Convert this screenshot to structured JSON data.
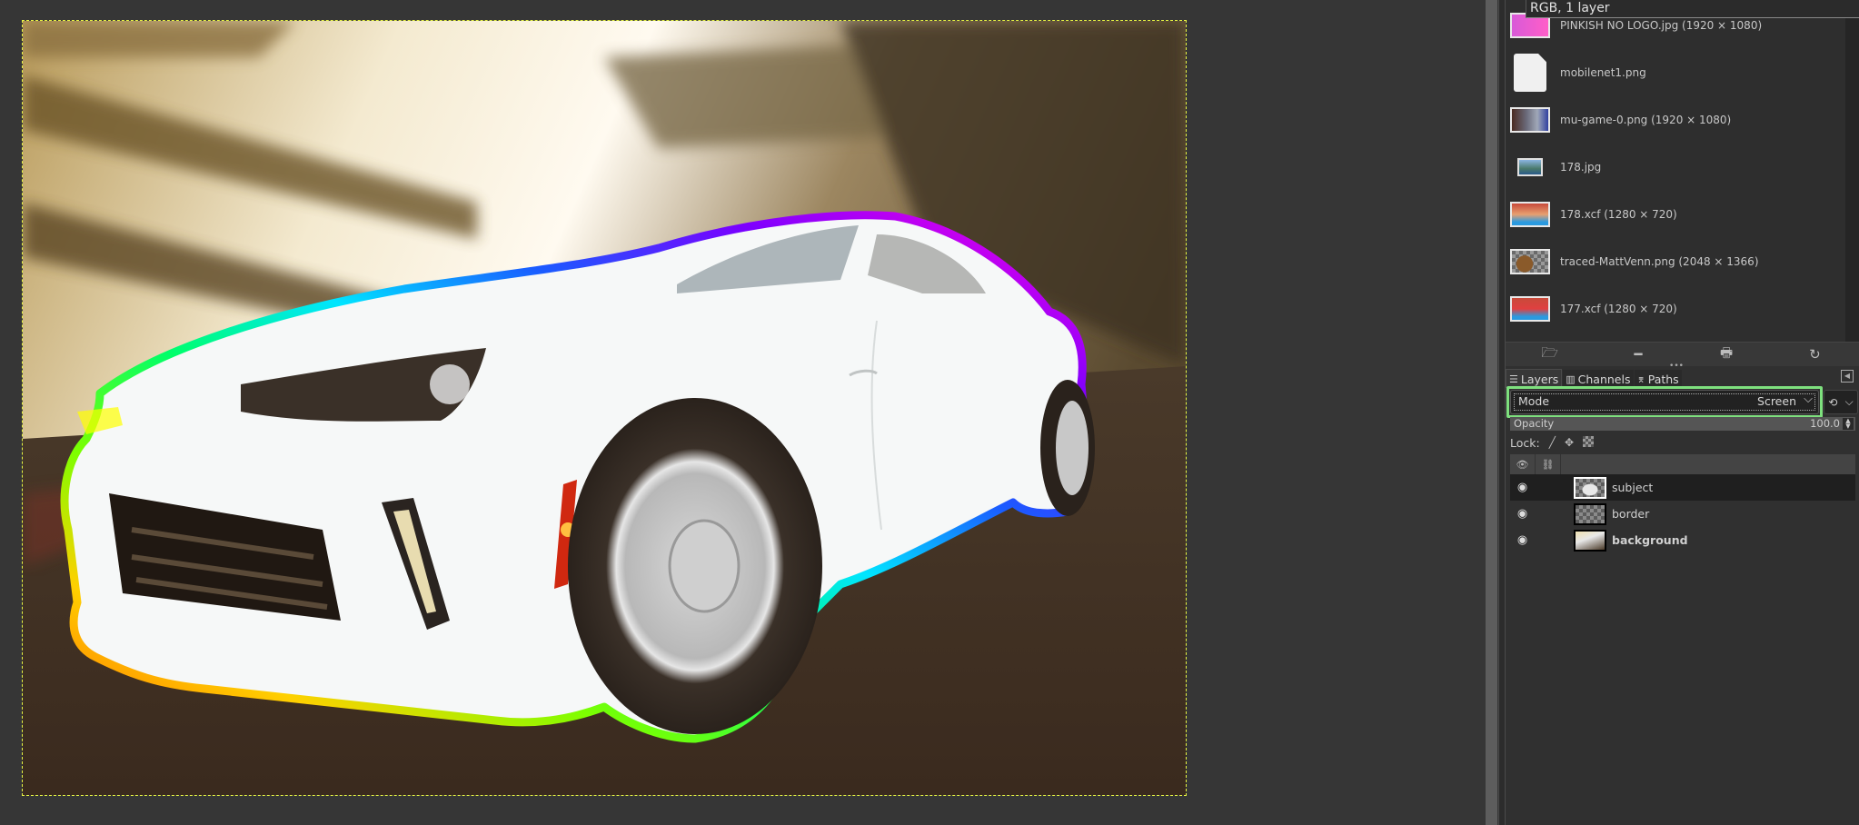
{
  "canvas": {
    "image_name": "photo of white sports car with rainbow outline on motion-blurred road",
    "selection_border_color": "#e8f542",
    "outline_gradient": [
      "#ff6a00",
      "#ffd000",
      "#ffff00",
      "#7cff00",
      "#00ff6a",
      "#00e5ff",
      "#1a5cff",
      "#7a00ff",
      "#ff00e6"
    ]
  },
  "tooltip": {
    "text": "RGB, 1 layer"
  },
  "images_panel": {
    "items": [
      {
        "label": "PINKISH NO LOGO.jpg (1920 × 1080)",
        "thumb": "pink-gradient"
      },
      {
        "label": "mobilenet1.png",
        "thumb": "blank-document"
      },
      {
        "label": "mu-game-0.png (1920 × 1080)",
        "thumb": "game-screenshot"
      },
      {
        "label": "178.jpg",
        "thumb": "landscape"
      },
      {
        "label": "178.xcf (1280 × 720)",
        "thumb": "thumbnail-178"
      },
      {
        "label": "traced-MattVenn.png (2048 × 1366)",
        "thumb": "portrait-transparent"
      },
      {
        "label": "177.xcf (1280 × 720)",
        "thumb": "thumbnail-177"
      }
    ],
    "buttons": [
      {
        "name": "raise-view-button",
        "icon": "🗁"
      },
      {
        "name": "delete-image-button",
        "icon": "━"
      },
      {
        "name": "new-display-button",
        "icon": "🖶"
      },
      {
        "name": "refresh-button",
        "icon": "↻"
      }
    ]
  },
  "tabs": [
    {
      "label": "Layers",
      "icon": "☰",
      "active": true
    },
    {
      "label": "Channels",
      "icon": "▥",
      "active": false
    },
    {
      "label": "Paths",
      "icon": "⌆",
      "active": false
    }
  ],
  "layers_panel": {
    "mode_label": "Mode",
    "mode_value": "Screen",
    "opacity_label": "Opacity",
    "opacity_value": "100.0",
    "opacity_percent": 100,
    "lock_label": "Lock:",
    "layers": [
      {
        "name": "subject",
        "visible": true,
        "selected": true,
        "bold": false
      },
      {
        "name": "border",
        "visible": true,
        "selected": false,
        "bold": false
      },
      {
        "name": "background",
        "visible": true,
        "selected": false,
        "bold": true
      }
    ]
  },
  "colors": {
    "highlight": "#7ee07e",
    "panel_bg": "#303030",
    "canvas_bg": "#363636"
  }
}
